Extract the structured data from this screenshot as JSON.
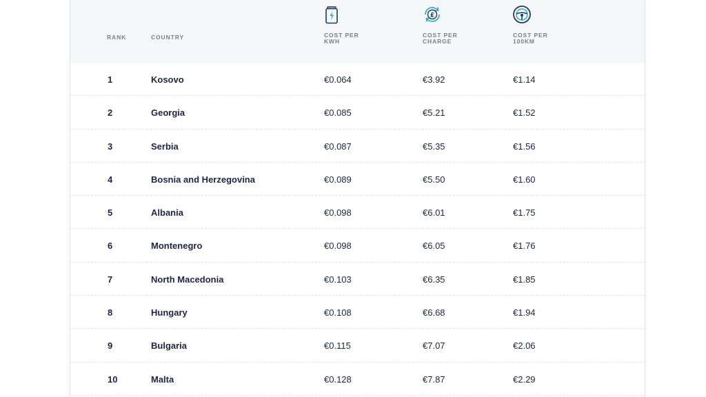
{
  "table": {
    "headers": {
      "rank": "RANK",
      "country": "COUNTRY",
      "cost_per_kwh": "COST PER KWH",
      "cost_per_charge": "COST PER CHARGE",
      "cost_per_100km": "COST PER 100KM"
    },
    "header_icons": {
      "cost_per_kwh": "battery-charging-icon",
      "cost_per_charge": "pound-refresh-icon",
      "cost_per_100km": "steering-wheel-icon"
    },
    "rows": [
      {
        "rank": "1",
        "country": "Kosovo",
        "kwh": "€0.064",
        "charge": "€3.92",
        "km": "€1.14"
      },
      {
        "rank": "2",
        "country": "Georgia",
        "kwh": "€0.085",
        "charge": "€5.21",
        "km": "€1.52"
      },
      {
        "rank": "3",
        "country": "Serbia",
        "kwh": "€0.087",
        "charge": "€5.35",
        "km": "€1.56"
      },
      {
        "rank": "4",
        "country": "Bosnia and Herzegovina",
        "kwh": "€0.089",
        "charge": "€5.50",
        "km": "€1.60"
      },
      {
        "rank": "5",
        "country": "Albania",
        "kwh": "€0.098",
        "charge": "€6.01",
        "km": "€1.75"
      },
      {
        "rank": "6",
        "country": "Montenegro",
        "kwh": "€0.098",
        "charge": "€6.05",
        "km": "€1.76"
      },
      {
        "rank": "7",
        "country": "North Macedonia",
        "kwh": "€0.103",
        "charge": "€6.35",
        "km": "€1.85"
      },
      {
        "rank": "8",
        "country": "Hungary",
        "kwh": "€0.108",
        "charge": "€6.68",
        "km": "€1.94"
      },
      {
        "rank": "9",
        "country": "Bulgaria",
        "kwh": "€0.115",
        "charge": "€7.07",
        "km": "€2.06"
      },
      {
        "rank": "10",
        "country": "Malta",
        "kwh": "€0.128",
        "charge": "€7.87",
        "km": "€2.29"
      }
    ]
  },
  "colors": {
    "text_dark": "#1f2446",
    "header_bg": "#f5f6f8",
    "header_text": "#7a7f88",
    "icon_navy": "#1f3a5c",
    "icon_teal": "#2aa6c8"
  }
}
